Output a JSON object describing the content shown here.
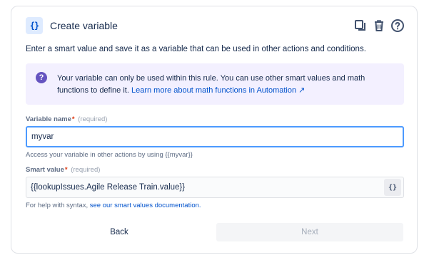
{
  "dialog": {
    "title": "Create variable",
    "icon_glyph": "{}",
    "description": "Enter a smart value and save it as a variable that can be used in other actions and conditions.",
    "actions": [
      "copy-icon",
      "trash-icon",
      "help-circle-icon"
    ]
  },
  "info": {
    "text": "Your variable can only be used within this rule. You can use other smart values and math functions to define it.",
    "link": "Learn more about math functions in Automation ↗"
  },
  "variable_name": {
    "label": "Variable name",
    "required_mark": "*",
    "required_text": "(required)",
    "value": "myvar",
    "help": "Access your variable in other actions by using {{myvar}}"
  },
  "smart_value": {
    "label": "Smart value",
    "required_mark": "*",
    "required_text": "(required)",
    "value": "{{lookupIssues.Agile Release Train.value}}",
    "button_glyph": "{}",
    "help_prefix": "For help with syntax,",
    "help_link": "see our smart values documentation."
  },
  "footer": {
    "back_label": "Back",
    "next_label": "Next"
  },
  "colors": {
    "accent": "#0052cc",
    "info_bg": "#f3f0ff",
    "info_icon": "#6554c0",
    "focus_border": "#4c9aff"
  }
}
